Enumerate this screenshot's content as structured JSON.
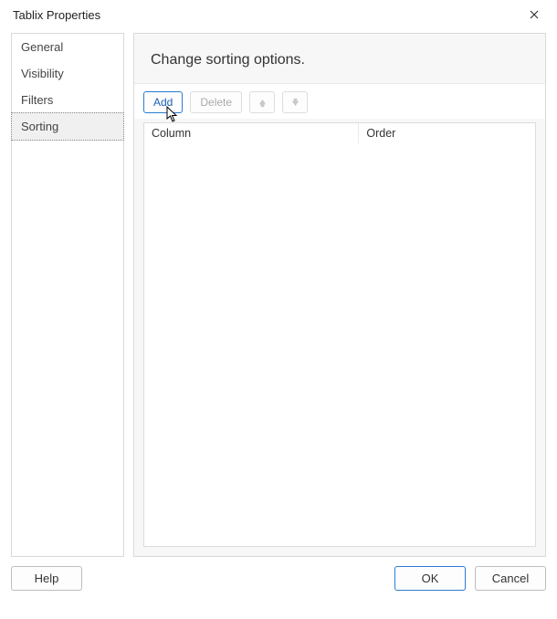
{
  "window": {
    "title": "Tablix Properties"
  },
  "sidebar": {
    "items": [
      {
        "label": "General"
      },
      {
        "label": "Visibility"
      },
      {
        "label": "Filters"
      },
      {
        "label": "Sorting",
        "selected": true
      }
    ]
  },
  "main": {
    "heading": "Change sorting options.",
    "toolbar": {
      "add_label": "Add",
      "delete_label": "Delete"
    },
    "table": {
      "columns": {
        "column_label": "Column",
        "order_label": "Order"
      },
      "rows": []
    }
  },
  "footer": {
    "help_label": "Help",
    "ok_label": "OK",
    "cancel_label": "Cancel"
  }
}
